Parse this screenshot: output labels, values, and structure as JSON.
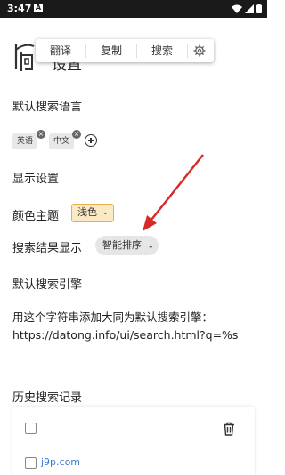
{
  "status_bar": {
    "time": "3:47",
    "notification_icon": "A"
  },
  "header": {
    "title": "设置"
  },
  "selection_toolbar": {
    "translate": "翻译",
    "copy": "复制",
    "search": "搜索"
  },
  "sections": {
    "default_language": "默认搜索语言",
    "display_settings": "显示设置",
    "color_theme": "颜色主题",
    "result_display": "搜索结果显示",
    "default_engine": "默认搜索引擎",
    "history": "历史搜索记录"
  },
  "languages": [
    {
      "label": "英语"
    },
    {
      "label": "中文"
    }
  ],
  "chip_remove_glyph": "×",
  "color_theme_value": "浅色",
  "result_display_value": "智能排序",
  "engine_description": "用这个字符串添加大同为默认搜索引擎：",
  "engine_url": "https://datong.info/ui/search.html?q=%s",
  "history_items": [
    {
      "label": "j9p.com"
    }
  ],
  "colors": {
    "accent_theme_border": "#e8b046",
    "accent_theme_fill": "#fbe9c6",
    "link": "#3a7bd5",
    "annotation_arrow": "#d42a2a"
  }
}
